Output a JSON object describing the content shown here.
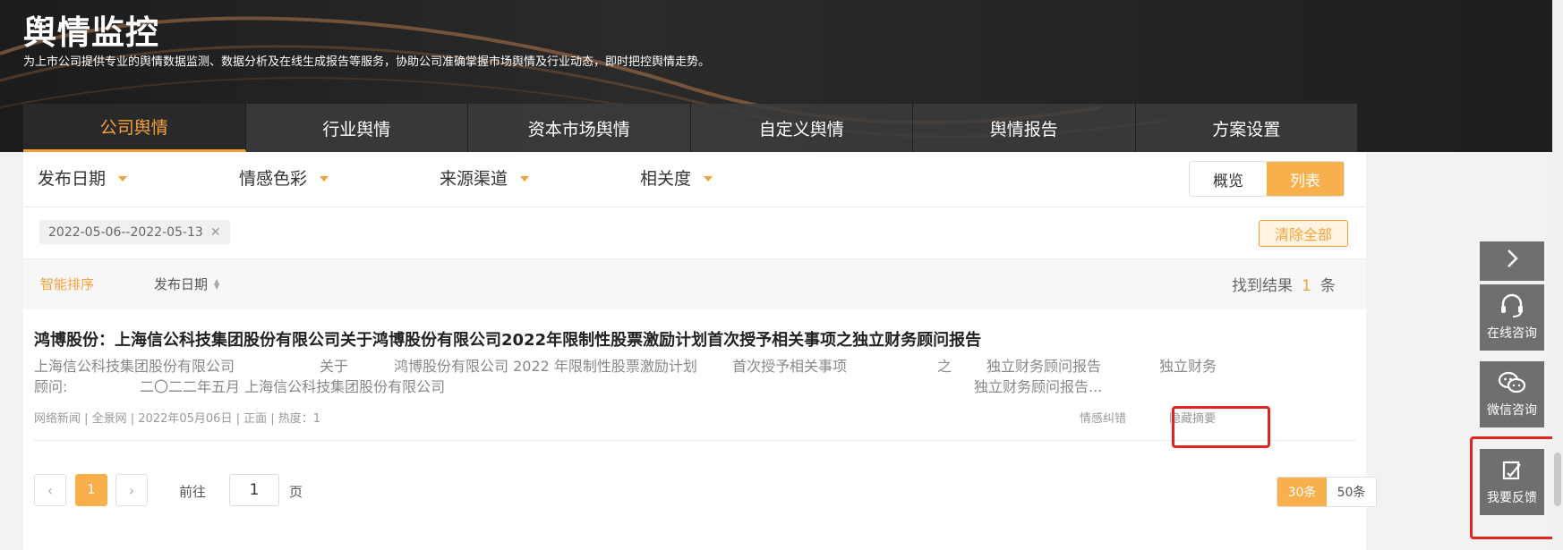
{
  "header": {
    "title": "舆情监控",
    "subtitle": "为上市公司提供专业的舆情数据监测、数据分析及在线生成报告等服务，协助公司准确掌握市场舆情及行业动态，即时把控舆情走势。"
  },
  "tabs": [
    {
      "label": "公司舆情",
      "active": true
    },
    {
      "label": "行业舆情"
    },
    {
      "label": "资本市场舆情"
    },
    {
      "label": "自定义舆情"
    },
    {
      "label": "舆情报告"
    },
    {
      "label": "方案设置"
    }
  ],
  "filters": {
    "publish_date": "发布日期",
    "sentiment": "情感色彩",
    "source": "来源渠道",
    "relevance": "相关度"
  },
  "view": {
    "overview": "概览",
    "list": "列表",
    "active": "list"
  },
  "active_tags": {
    "date_range": "2022-05-06--2022-05-13",
    "remove": "✕"
  },
  "clear_all": "清除全部",
  "sort": {
    "smart": "智能排序",
    "date": "发布日期"
  },
  "results": {
    "prefix": "找到结果",
    "count": "1",
    "suffix": "条"
  },
  "item": {
    "title": "鸿博股份：上海信公科技集团股份有限公司关于鸿博股份有限公司2022年限制性股票激励计划首次授予相关事项之独立财务顾问报告",
    "summary": {
      "l1a": "上海信公科技集团股份有限公司",
      "l1b": "关于",
      "l1c": "鸿博股份有限公司 2022 年限制性股票激励计划",
      "l1d": "首次授予相关事项",
      "l1e": "之",
      "l1f": "独立财务顾问报告",
      "l1g": "独立财务",
      "l2a": "顾问:",
      "l2b": "二〇二二年五月 上海信公科技集团股份有限公司",
      "l2c": "独立财务顾问报告..."
    },
    "meta": "网络新闻 | 全景网 | 2022年05月06日 | 正面 | 热度：1",
    "correct_sentiment": "情感纠错",
    "hide_summary": "隐藏摘要"
  },
  "pagination": {
    "prev": "‹",
    "current": "1",
    "next": "›",
    "goto_prefix": "前往",
    "goto_value": "1",
    "goto_suffix": "页",
    "sizes": [
      "30条",
      "50条"
    ]
  },
  "float_bar": {
    "online": "在线咨询",
    "wechat": "微信咨询",
    "feedback": "我要反馈"
  },
  "colors": {
    "accent": "#f5a13a",
    "highlight": "#e52222",
    "header_bg": "#1e1e1e"
  }
}
